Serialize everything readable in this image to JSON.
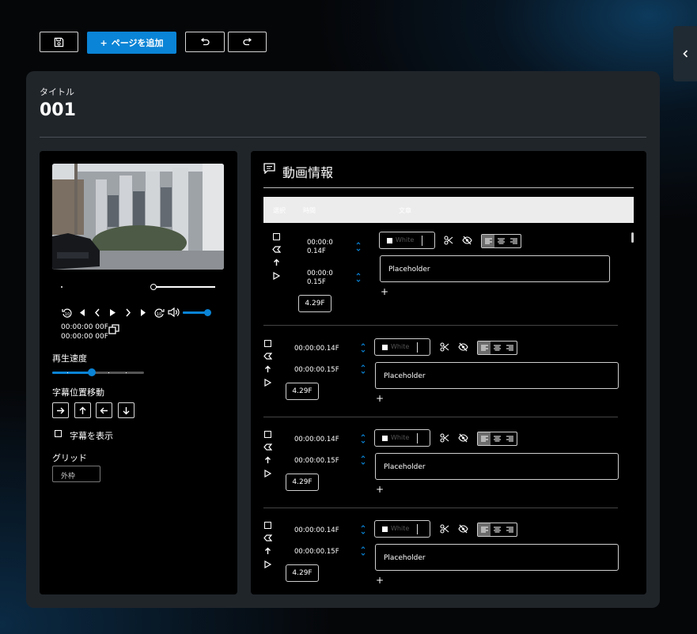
{
  "toolbar": {
    "add_page_label": "ページを追加",
    "add_page_prefix": "+"
  },
  "header": {
    "title_label": "タイトル",
    "title_value": "001"
  },
  "player": {
    "timecode_current": "00:00:00 00F",
    "timecode_total": "00:00:00 00F",
    "seek_progress": 0.6,
    "volume_level": 1.0
  },
  "left": {
    "speed_label": "再生速度",
    "speed_level": 0.3,
    "position_label": "字幕位置移動",
    "show_subtitles_label": "字幕を表示",
    "grid_label": "グリッド",
    "grid_value": "外枠"
  },
  "right": {
    "title": "動画情報",
    "columns": [
      "選択",
      "時間",
      "文章"
    ],
    "rows": [
      {
        "start": "00:00:0\n0.14F",
        "end": "00:00:0\n0.15F",
        "duration": "4.29F",
        "color": "White",
        "text": "Placeholder",
        "add": "+"
      },
      {
        "start": "00:00:00.14F",
        "end": "00:00:00.15F",
        "duration": "4.29F",
        "color": "White",
        "text": "Placeholder",
        "add": "+"
      },
      {
        "start": "00:00:00.14F",
        "end": "00:00:00.15F",
        "duration": "4.29F",
        "color": "White",
        "text": "Placeholder",
        "add": "+"
      },
      {
        "start": "00:00:00.14F",
        "end": "00:00:00.15F",
        "duration": "4.29F",
        "color": "White",
        "text": "Placeholder",
        "add": "+"
      }
    ]
  },
  "colors": {
    "accent": "#0a84d6",
    "card": "#20252a",
    "panel": "#000000"
  }
}
